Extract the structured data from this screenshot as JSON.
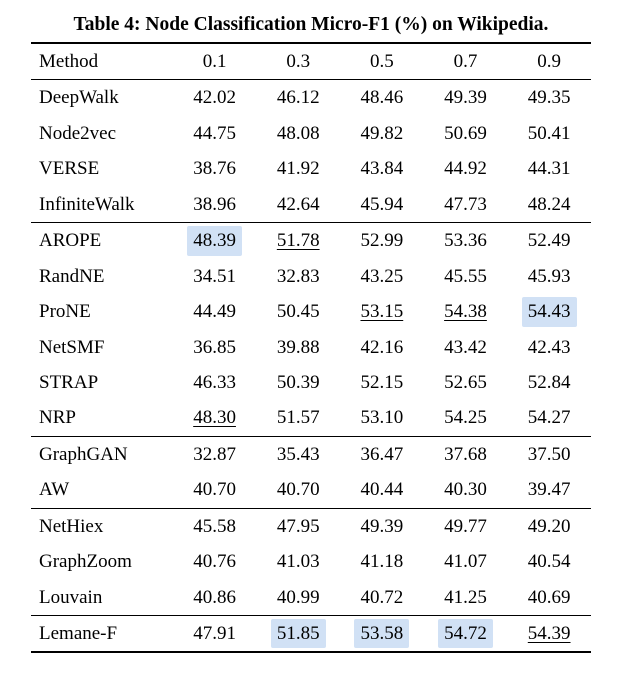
{
  "title": "Table 4: Node Classification Micro-F1 (%) on Wikipedia.",
  "headers": [
    "Method",
    "0.1",
    "0.3",
    "0.5",
    "0.7",
    "0.9"
  ],
  "groups": [
    {
      "rows": [
        {
          "m": "DeepWalk",
          "v": [
            {
              "t": "42.02"
            },
            {
              "t": "46.12"
            },
            {
              "t": "48.46"
            },
            {
              "t": "49.39"
            },
            {
              "t": "49.35"
            }
          ]
        },
        {
          "m": "Node2vec",
          "v": [
            {
              "t": "44.75"
            },
            {
              "t": "48.08"
            },
            {
              "t": "49.82"
            },
            {
              "t": "50.69"
            },
            {
              "t": "50.41"
            }
          ]
        },
        {
          "m": "VERSE",
          "v": [
            {
              "t": "38.76"
            },
            {
              "t": "41.92"
            },
            {
              "t": "43.84"
            },
            {
              "t": "44.92"
            },
            {
              "t": "44.31"
            }
          ]
        },
        {
          "m": "InfiniteWalk",
          "v": [
            {
              "t": "38.96"
            },
            {
              "t": "42.64"
            },
            {
              "t": "45.94"
            },
            {
              "t": "47.73"
            },
            {
              "t": "48.24"
            }
          ]
        }
      ]
    },
    {
      "rows": [
        {
          "m": "AROPE",
          "v": [
            {
              "t": "48.39",
              "hl": true
            },
            {
              "t": "51.78",
              "ul": true
            },
            {
              "t": "52.99"
            },
            {
              "t": "53.36"
            },
            {
              "t": "52.49"
            }
          ]
        },
        {
          "m": "RandNE",
          "v": [
            {
              "t": "34.51"
            },
            {
              "t": "32.83"
            },
            {
              "t": "43.25"
            },
            {
              "t": "45.55"
            },
            {
              "t": "45.93"
            }
          ]
        },
        {
          "m": "ProNE",
          "v": [
            {
              "t": "44.49"
            },
            {
              "t": "50.45"
            },
            {
              "t": "53.15",
              "ul": true
            },
            {
              "t": "54.38",
              "ul": true
            },
            {
              "t": "54.43",
              "hl": true
            }
          ]
        },
        {
          "m": "NetSMF",
          "v": [
            {
              "t": "36.85"
            },
            {
              "t": "39.88"
            },
            {
              "t": "42.16"
            },
            {
              "t": "43.42"
            },
            {
              "t": "42.43"
            }
          ]
        },
        {
          "m": "STRAP",
          "v": [
            {
              "t": "46.33"
            },
            {
              "t": "50.39"
            },
            {
              "t": "52.15"
            },
            {
              "t": "52.65"
            },
            {
              "t": "52.84"
            }
          ]
        },
        {
          "m": "NRP",
          "v": [
            {
              "t": "48.30",
              "ul": true
            },
            {
              "t": "51.57"
            },
            {
              "t": "53.10"
            },
            {
              "t": "54.25"
            },
            {
              "t": "54.27"
            }
          ]
        }
      ]
    },
    {
      "rows": [
        {
          "m": "GraphGAN",
          "v": [
            {
              "t": "32.87"
            },
            {
              "t": "35.43"
            },
            {
              "t": "36.47"
            },
            {
              "t": "37.68"
            },
            {
              "t": "37.50"
            }
          ]
        },
        {
          "m": "AW",
          "v": [
            {
              "t": "40.70"
            },
            {
              "t": "40.70"
            },
            {
              "t": "40.44"
            },
            {
              "t": "40.30"
            },
            {
              "t": "39.47"
            }
          ]
        }
      ]
    },
    {
      "rows": [
        {
          "m": "NetHiex",
          "v": [
            {
              "t": "45.58"
            },
            {
              "t": "47.95"
            },
            {
              "t": "49.39"
            },
            {
              "t": "49.77"
            },
            {
              "t": "49.20"
            }
          ]
        },
        {
          "m": "GraphZoom",
          "v": [
            {
              "t": "40.76"
            },
            {
              "t": "41.03"
            },
            {
              "t": "41.18"
            },
            {
              "t": "41.07"
            },
            {
              "t": "40.54"
            }
          ]
        },
        {
          "m": "Louvain",
          "v": [
            {
              "t": "40.86"
            },
            {
              "t": "40.99"
            },
            {
              "t": "40.72"
            },
            {
              "t": "41.25"
            },
            {
              "t": "40.69"
            }
          ]
        }
      ]
    },
    {
      "rows": [
        {
          "m": "Lemane-F",
          "v": [
            {
              "t": "47.91"
            },
            {
              "t": "51.85",
              "hl": true
            },
            {
              "t": "53.58",
              "hl": true
            },
            {
              "t": "54.72",
              "hl": true
            },
            {
              "t": "54.39",
              "ul": true
            }
          ]
        }
      ]
    }
  ],
  "chart_data": {
    "type": "table",
    "title": "Table 4: Node Classification Micro-F1 (%) on Wikipedia.",
    "columns": [
      "Method",
      "0.1",
      "0.3",
      "0.5",
      "0.7",
      "0.9"
    ],
    "rows": [
      [
        "DeepWalk",
        42.02,
        46.12,
        48.46,
        49.39,
        49.35
      ],
      [
        "Node2vec",
        44.75,
        48.08,
        49.82,
        50.69,
        50.41
      ],
      [
        "VERSE",
        38.76,
        41.92,
        43.84,
        44.92,
        44.31
      ],
      [
        "InfiniteWalk",
        38.96,
        42.64,
        45.94,
        47.73,
        48.24
      ],
      [
        "AROPE",
        48.39,
        51.78,
        52.99,
        53.36,
        52.49
      ],
      [
        "RandNE",
        34.51,
        32.83,
        43.25,
        45.55,
        45.93
      ],
      [
        "ProNE",
        44.49,
        50.45,
        53.15,
        54.38,
        54.43
      ],
      [
        "NetSMF",
        36.85,
        39.88,
        42.16,
        43.42,
        42.43
      ],
      [
        "STRAP",
        46.33,
        50.39,
        52.15,
        52.65,
        52.84
      ],
      [
        "NRP",
        48.3,
        51.57,
        53.1,
        54.25,
        54.27
      ],
      [
        "GraphGAN",
        32.87,
        35.43,
        36.47,
        37.68,
        37.5
      ],
      [
        "AW",
        40.7,
        40.7,
        40.44,
        40.3,
        39.47
      ],
      [
        "NetHiex",
        45.58,
        47.95,
        49.39,
        49.77,
        49.2
      ],
      [
        "GraphZoom",
        40.76,
        41.03,
        41.18,
        41.07,
        40.54
      ],
      [
        "Louvain",
        40.86,
        40.99,
        40.72,
        41.25,
        40.69
      ],
      [
        "Lemane-F",
        47.91,
        51.85,
        53.58,
        54.72,
        54.39
      ]
    ],
    "highlighted_cells": [
      [
        4,
        1
      ],
      [
        6,
        5
      ],
      [
        15,
        2
      ],
      [
        15,
        3
      ],
      [
        15,
        4
      ]
    ],
    "underlined_cells": [
      [
        4,
        2
      ],
      [
        6,
        3
      ],
      [
        6,
        4
      ],
      [
        9,
        1
      ],
      [
        15,
        5
      ]
    ]
  }
}
